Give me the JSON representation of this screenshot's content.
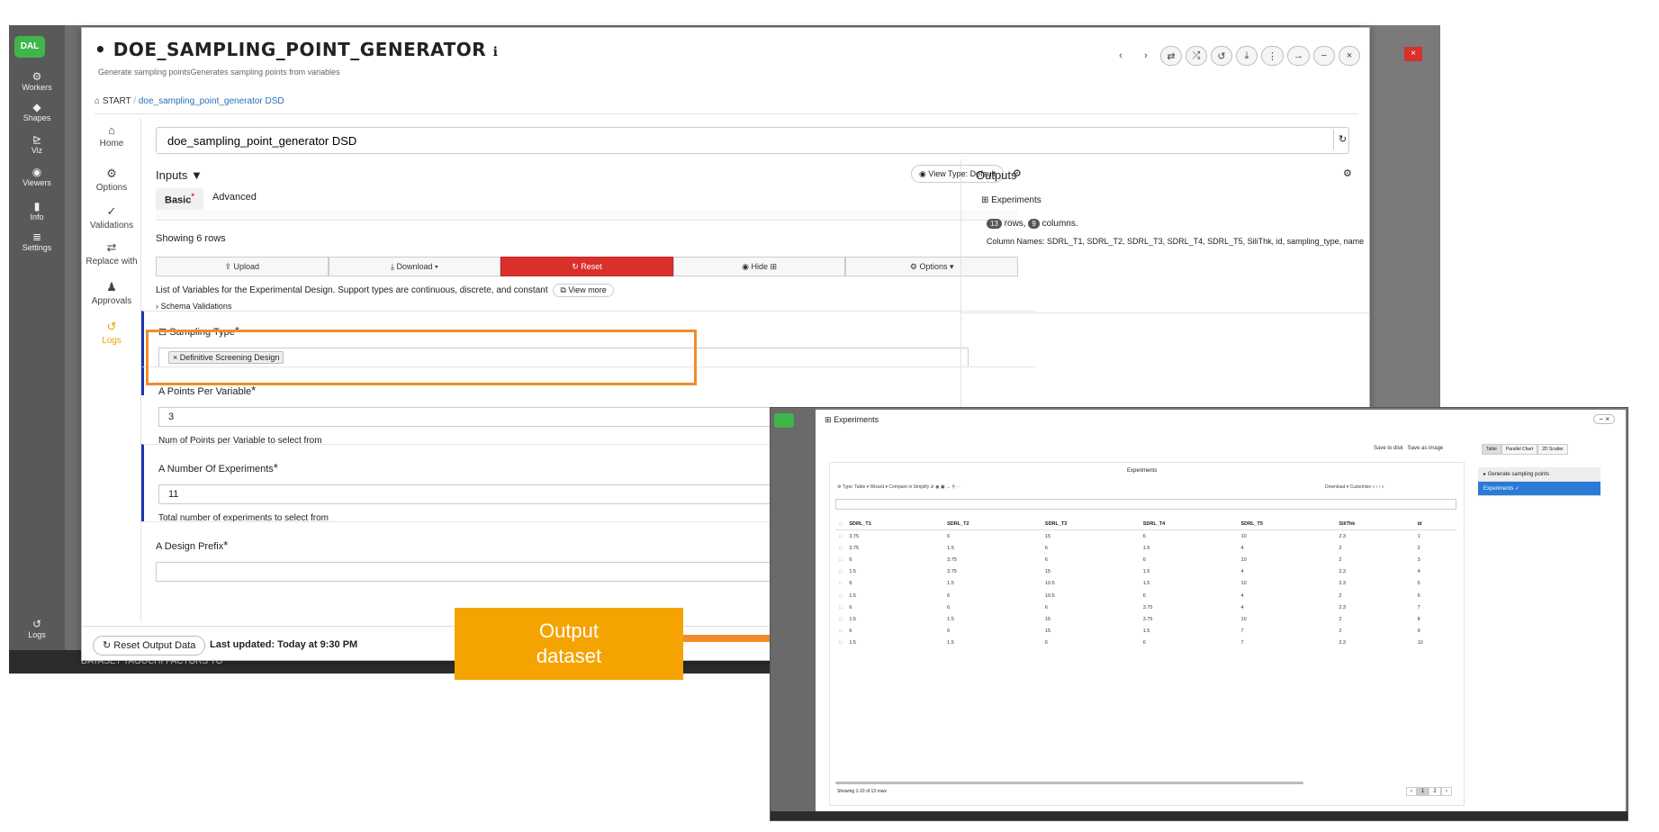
{
  "bg_app": {
    "sidebar": [
      {
        "icon": "gear-icon",
        "glyph": "⚙",
        "label": "Workers"
      },
      {
        "icon": "diamond-icon",
        "glyph": "◆",
        "label": "Shapes"
      },
      {
        "icon": "chart-icon",
        "glyph": "⊵",
        "label": "Viz"
      },
      {
        "icon": "eye-icon",
        "glyph": "◉",
        "label": "Viewers"
      },
      {
        "icon": "info-icon",
        "glyph": "▮",
        "label": "Info"
      },
      {
        "icon": "settings-icon",
        "glyph": "≣",
        "label": "Settings"
      },
      {
        "icon": "logs-icon",
        "glyph": "↺",
        "label": "Logs"
      }
    ],
    "bottom_text": "DATASET TAGUCHI FACTORS TO",
    "logo": "DAL"
  },
  "modal": {
    "title": "DOE_SAMPLING_POINT_GENERATOR",
    "subtitle": "Generate sampling pointsGenerates sampling points from variables",
    "breadcrumb_start": "START",
    "breadcrumb_current": "doe_sampling_point_generator DSD",
    "name_value": "doe_sampling_point_generator DSD",
    "actions": [
      "‹",
      "›",
      "⇄",
      "⤮",
      "↺",
      "⤓",
      "⋮",
      "→",
      "−",
      "×"
    ]
  },
  "left_nav": [
    {
      "icon": "home-icon",
      "glyph": "⌂",
      "label": "Home"
    },
    {
      "icon": "gear-icon",
      "glyph": "⚙",
      "label": "Options"
    },
    {
      "icon": "check-icon",
      "glyph": "✓",
      "label": "Validations"
    },
    {
      "icon": "swap-icon",
      "glyph": "⇄",
      "label": "Replace with"
    },
    {
      "icon": "user-check-icon",
      "glyph": "♟",
      "label": "Approvals"
    },
    {
      "icon": "logs-icon",
      "glyph": "↺",
      "label": "Logs"
    }
  ],
  "inputs": {
    "title": "Inputs",
    "view_type": "View Type: Default",
    "tabs": [
      "Basic",
      "Advanced"
    ],
    "showing_rows": "Showing 6 rows",
    "actions": [
      "Upload",
      "Download ▾",
      "Reset",
      "Hide ⊞",
      "Options ▾"
    ],
    "vars_desc": "List of Variables for the Experimental Design. Support types are continuous, discrete, and constant",
    "view_more": "View more",
    "schema_validations": "Schema Validations",
    "sampling_type_label": "Sampling Type",
    "sampling_type_value": "Definitive Screening Design",
    "points_label": "Points Per Variable",
    "points_value": "3",
    "points_help": "Num of Points per Variable to select from",
    "experiments_label": "Number Of Experiments",
    "experiments_value": "11",
    "experiments_help": "Total number of experiments to select from",
    "prefix_label": "Design Prefix"
  },
  "outputs": {
    "title": "Outputs",
    "experiments_title": "Experiments",
    "rows": "13",
    "rows_word": "rows,",
    "cols": "9",
    "cols_word": "columns.",
    "column_names": "Column Names: SDRL_T1, SDRL_T2, SDRL_T3, SDRL_T4, SDRL_T5, SiliThk, id, sampling_type, name"
  },
  "footer": {
    "reset_output": "Reset Output Data",
    "last_updated": "Last updated: Today at 9:30 PM"
  },
  "callout": {
    "line1": "Output",
    "line2": "dataset",
    "color": "#f5a300"
  },
  "exp_window": {
    "title": "Experiments",
    "save_disk": "Save to disk",
    "save_image": "Save as image",
    "view_tabs": [
      "Table",
      "Parallel Chart",
      "2D Scatter"
    ],
    "side_items": [
      "Generate sampling points",
      "Experiments ✓"
    ],
    "panel_title": "Experiments",
    "toolbar": "⚙ Type: Table ▾   Wizard ▾   Compare in Simplify   ⇵   ◉   ▣   ↔   ⚲   ⋯",
    "toolbar2": "Download ▾   Customize   «   ‹   ›   »",
    "columns": [
      "SDRL_T1",
      "SDRL_T2",
      "SDRL_T3",
      "SDRL_T4",
      "SDRL_T5",
      "SiliThk",
      "id"
    ],
    "rows": [
      [
        "3.75",
        "6",
        "15",
        "6",
        "10",
        "2.3",
        "1"
      ],
      [
        "3.75",
        "1.5",
        "6",
        "1.5",
        "4",
        "2",
        "2"
      ],
      [
        "6",
        "3.75",
        "6",
        "6",
        "10",
        "2",
        "3"
      ],
      [
        "1.5",
        "3.75",
        "15",
        "1.5",
        "4",
        "2.3",
        "4"
      ],
      [
        "6",
        "1.5",
        "10.5",
        "1.5",
        "10",
        "2.3",
        "5"
      ],
      [
        "1.5",
        "6",
        "10.5",
        "6",
        "4",
        "2",
        "6"
      ],
      [
        "6",
        "6",
        "6",
        "3.75",
        "4",
        "2.3",
        "7"
      ],
      [
        "1.5",
        "1.5",
        "15",
        "3.75",
        "10",
        "2",
        "8"
      ],
      [
        "6",
        "6",
        "15",
        "1.5",
        "7",
        "2",
        "9"
      ],
      [
        "1.5",
        "1.5",
        "6",
        "6",
        "7",
        "2.3",
        "10"
      ]
    ],
    "showing": "Showing 1-10 of 13 rows",
    "pager": [
      "‹",
      "1",
      "2",
      "›"
    ]
  }
}
